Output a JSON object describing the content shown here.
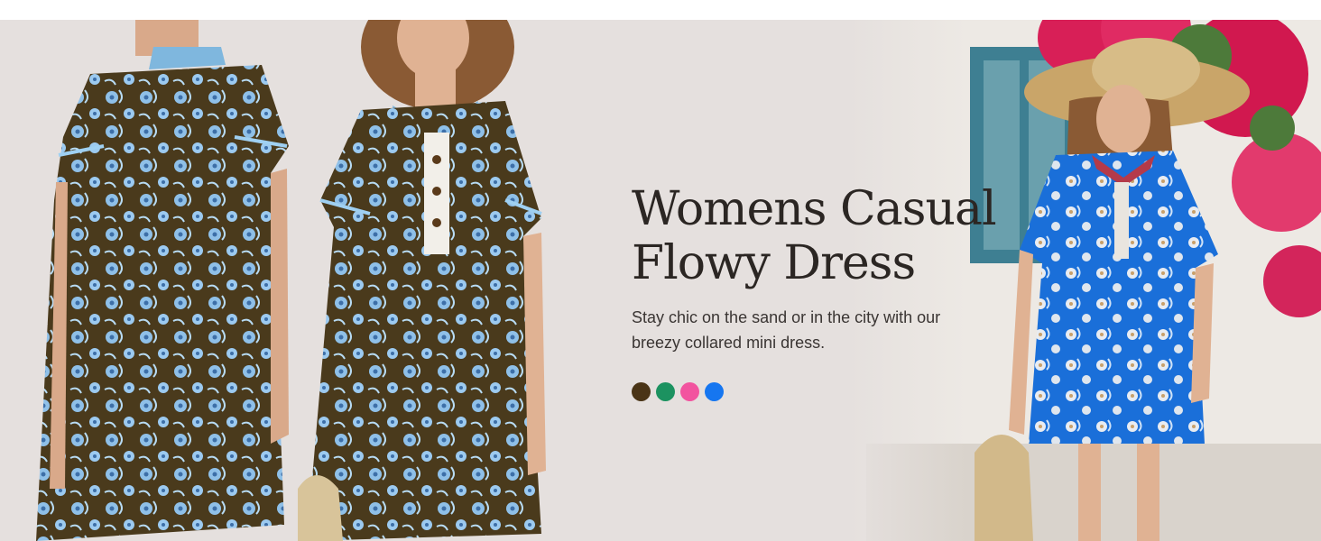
{
  "hero": {
    "headline_line1": "Womens Casual",
    "headline_line2": "Flowy Dress",
    "description": "Stay chic on the sand or in the city with our breezy collared mini dress."
  },
  "colors": {
    "background": "#e5e0de",
    "text": "#2b2623",
    "dress_brown": "#4a3a1c",
    "flower_blue": "#8fc0e8",
    "dress_blue": "#1a6fd9"
  },
  "swatches": [
    {
      "name": "brown",
      "color": "#4a3416"
    },
    {
      "name": "green",
      "color": "#1c9260"
    },
    {
      "name": "pink",
      "color": "#f2549f"
    },
    {
      "name": "blue",
      "color": "#1676f0"
    }
  ],
  "photos": [
    {
      "name": "model-back-view",
      "icon": "dress-back-photo"
    },
    {
      "name": "model-front-view",
      "icon": "dress-front-photo"
    },
    {
      "name": "model-outdoor-blue",
      "icon": "dress-outdoor-photo"
    }
  ]
}
